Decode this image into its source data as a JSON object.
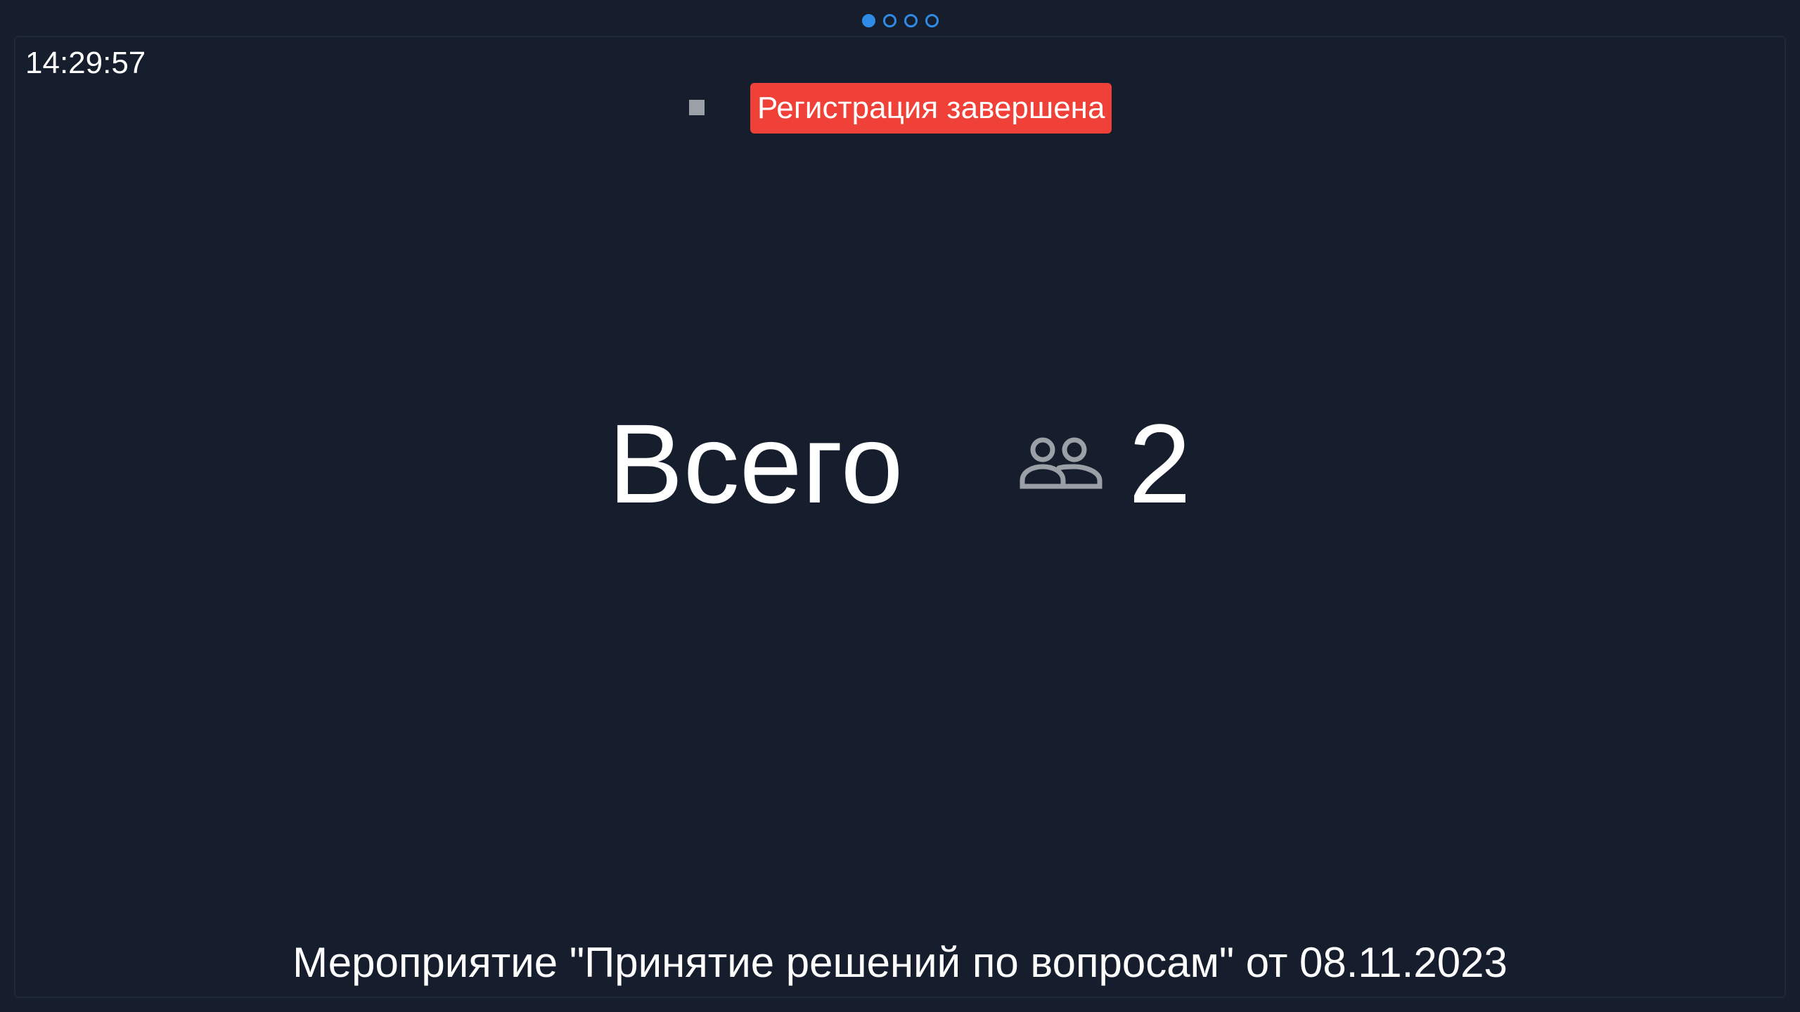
{
  "pager": {
    "pages": [
      {
        "active": true
      },
      {
        "active": false
      },
      {
        "active": false
      },
      {
        "active": false
      }
    ]
  },
  "clock": "14:29:57",
  "status": {
    "indicator_icon": "stop-square-icon",
    "label": "Регистрация завершена",
    "color": "#ef4137"
  },
  "summary": {
    "label": "Всего",
    "icon": "people-icon",
    "count": "2"
  },
  "event": {
    "title": "Мероприятие \"Принятие решений по вопросам\" от 08.11.2023"
  },
  "colors": {
    "background": "#161e2e",
    "accent": "#2f8be6",
    "status_red": "#ef4137",
    "icon_gray": "#9aa0a6"
  }
}
